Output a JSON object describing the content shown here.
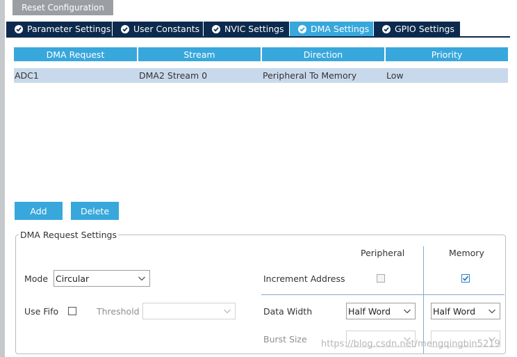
{
  "toolbar": {
    "reset_label": "Reset Configuration"
  },
  "tabs": [
    {
      "label": "Parameter Settings",
      "active": false
    },
    {
      "label": "User Constants",
      "active": false
    },
    {
      "label": "NVIC Settings",
      "active": false
    },
    {
      "label": "DMA Settings",
      "active": true
    },
    {
      "label": "GPIO Settings",
      "active": false
    }
  ],
  "table": {
    "columns": [
      "DMA Request",
      "Stream",
      "Direction",
      "Priority"
    ],
    "rows": [
      [
        "ADC1",
        "DMA2 Stream 0",
        "Peripheral To Memory",
        "Low"
      ]
    ]
  },
  "actions": {
    "add_label": "Add",
    "delete_label": "Delete"
  },
  "settings": {
    "title": "DMA Request Settings",
    "peripheral_header": "Peripheral",
    "memory_header": "Memory",
    "mode_label": "Mode",
    "mode_value": "Circular",
    "increment_label": "Increment Address",
    "increment_peripheral": false,
    "increment_memory": true,
    "use_fifo_label": "Use Fifo",
    "use_fifo": false,
    "threshold_label": "Threshold",
    "threshold_value": "",
    "data_width_label": "Data Width",
    "data_width_peripheral": "Half Word",
    "data_width_memory": "Half Word",
    "burst_size_label": "Burst Size",
    "burst_peripheral": "",
    "burst_memory": ""
  },
  "watermark": "https://blog.csdn.net/mengqingbin5219",
  "colors": {
    "tab_dark": "#0c2a4d",
    "accent": "#38a7dc",
    "selected_row": "#c9d9ec"
  }
}
